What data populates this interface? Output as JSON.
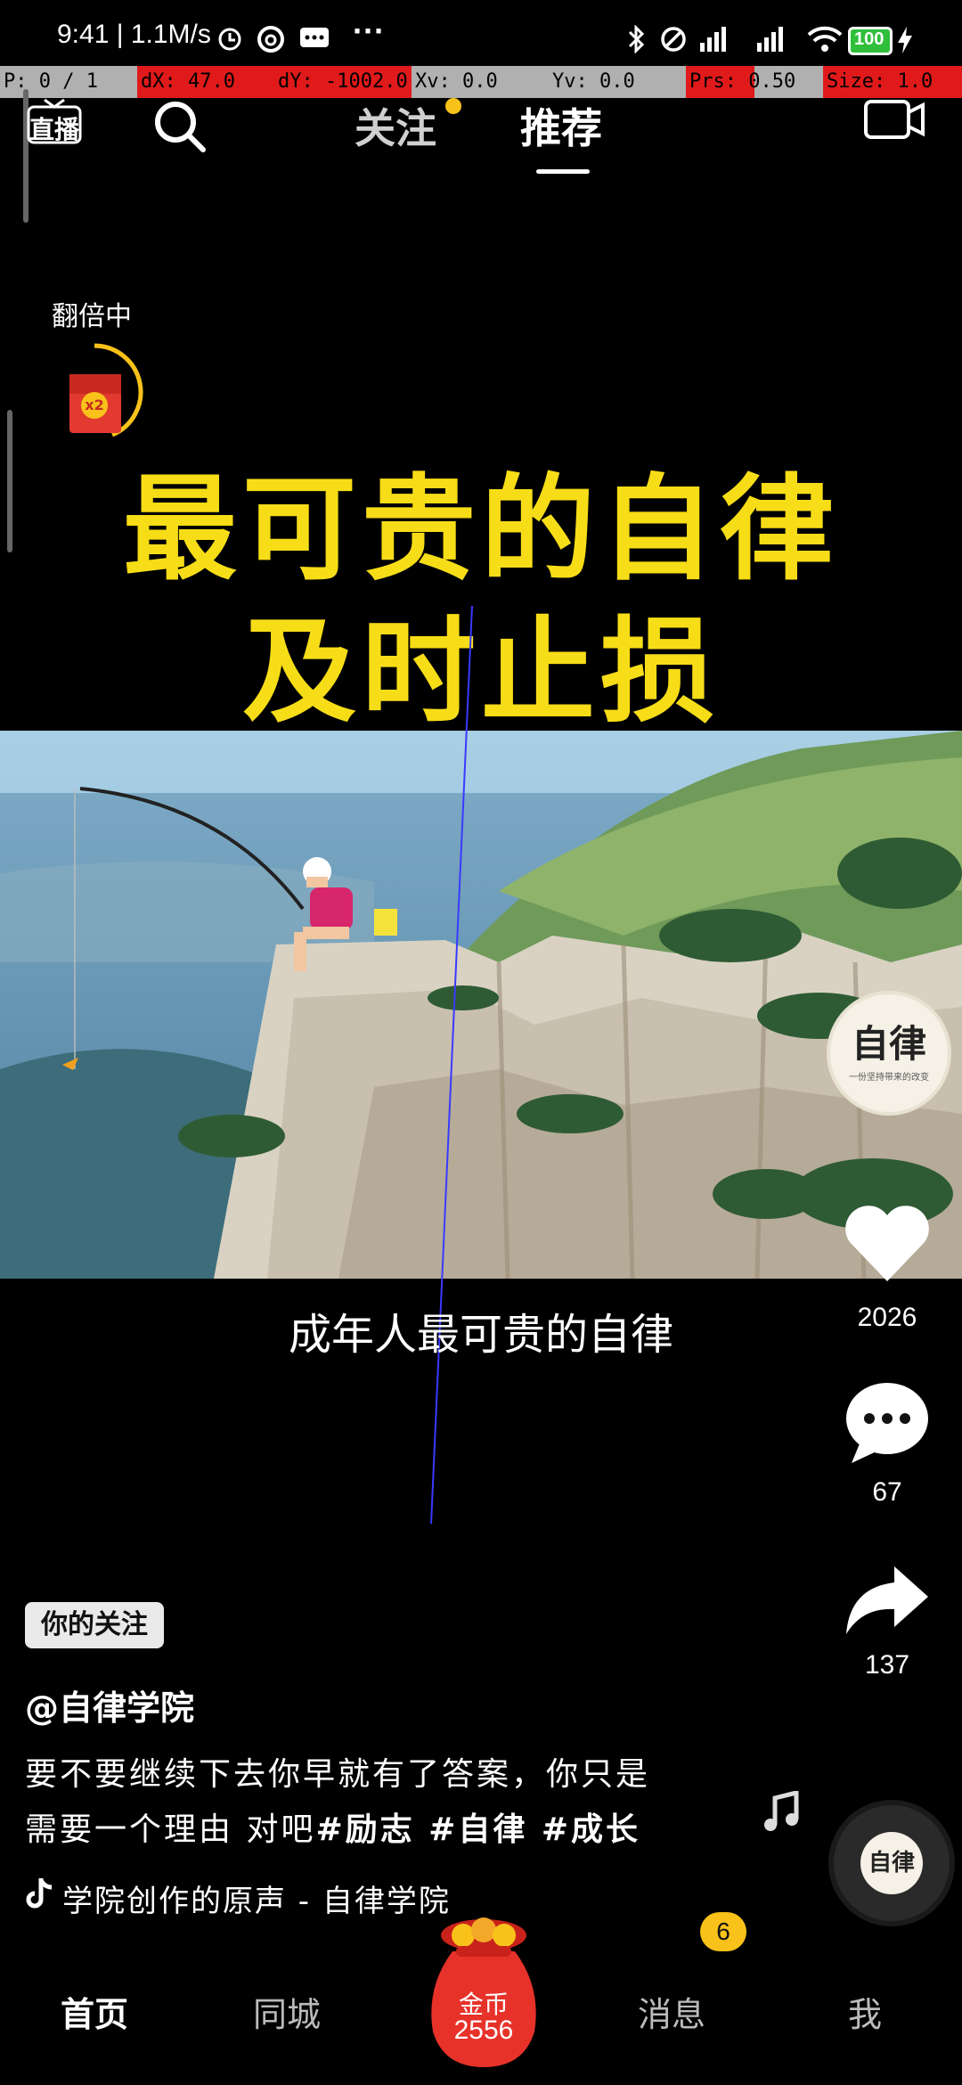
{
  "status_bar": {
    "time_speed": "9:41 | 1.1M/s",
    "more": "···",
    "battery": "100"
  },
  "debug_overlay": {
    "p": "P: 0 / 1",
    "dx": "dX: 47.0",
    "dy": "dY: -1002.0",
    "xv": "Xv: 0.0",
    "yv": "Yv: 0.0",
    "prs": "Prs: 0.50",
    "size": "Size: 1.0"
  },
  "top_nav": {
    "live": "直播",
    "following": "关注",
    "recommended": "推荐"
  },
  "reward": {
    "label": "翻倍中",
    "multiplier": "x2"
  },
  "video": {
    "headline_line1": "最可贵的自律",
    "headline_line2": "及时止损",
    "caption": "成年人最可贵的自律",
    "badge_title": "自律",
    "badge_sub": "一份坚持带来的改变"
  },
  "actions": {
    "likes": "2026",
    "comments": "67",
    "shares": "137"
  },
  "info": {
    "follow_tag": "你的关注",
    "author": "@自律学院",
    "description_line1": "要不要继续下去你早就有了答案，你只是",
    "description_line2_plain": "需要一个理由 对吧",
    "hashtags": "#励志 #自律 #成长",
    "music": "学院创作的原声 - 自律学院",
    "disc_text": "自律"
  },
  "bottom_nav": {
    "home": "首页",
    "nearby": "同城",
    "coins_label": "金币",
    "coins_value": "2556",
    "messages": "消息",
    "messages_badge": "6",
    "me": "我"
  },
  "colors": {
    "headline": "#f7dd17",
    "debug_red": "#e01a1a",
    "debug_gray": "#b0b0b0",
    "badge_yellow": "#f8c21a"
  }
}
